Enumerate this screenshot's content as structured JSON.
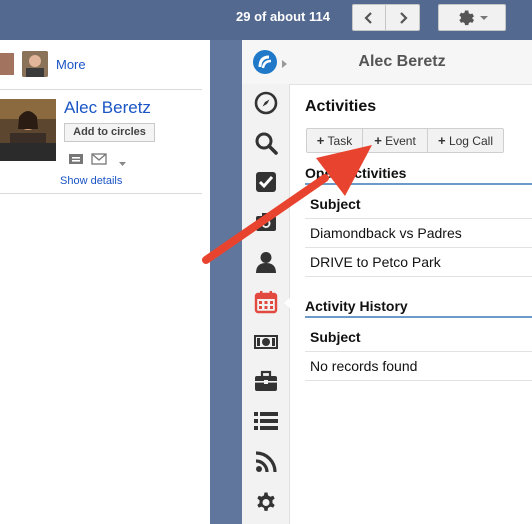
{
  "gmail": {
    "count_text": "29 of about 114",
    "more_label": "More",
    "contact_name": "Alec Beretz",
    "add_to_circles_label": "Add to circles",
    "show_details_label": "Show details"
  },
  "crm": {
    "header_name": "Alec Beretz",
    "activities_title": "Activities",
    "buttons": {
      "task": "Task",
      "event": "Event",
      "log_call": "Log Call"
    },
    "open_activities": {
      "title": "Open Activities",
      "column": "Subject",
      "rows": [
        "Diamondback vs Padres",
        "DRIVE to Petco Park"
      ]
    },
    "activity_history": {
      "title": "Activity History",
      "column": "Subject",
      "empty_text": "No records found"
    },
    "sidebar_icons": [
      "compass-icon",
      "search-icon",
      "checkbox-icon",
      "camera-icon",
      "person-icon",
      "calendar-icon",
      "money-icon",
      "briefcase-icon",
      "list-icon",
      "rss-icon",
      "gear-icon"
    ],
    "active_icon": "calendar-icon"
  },
  "colors": {
    "gmail_bar": "#54698f",
    "link": "#1a55c5",
    "arrow": "#e8432e",
    "calendar_active": "#e2493f",
    "section_rule": "#6d9bc9",
    "icon": "#333333"
  }
}
